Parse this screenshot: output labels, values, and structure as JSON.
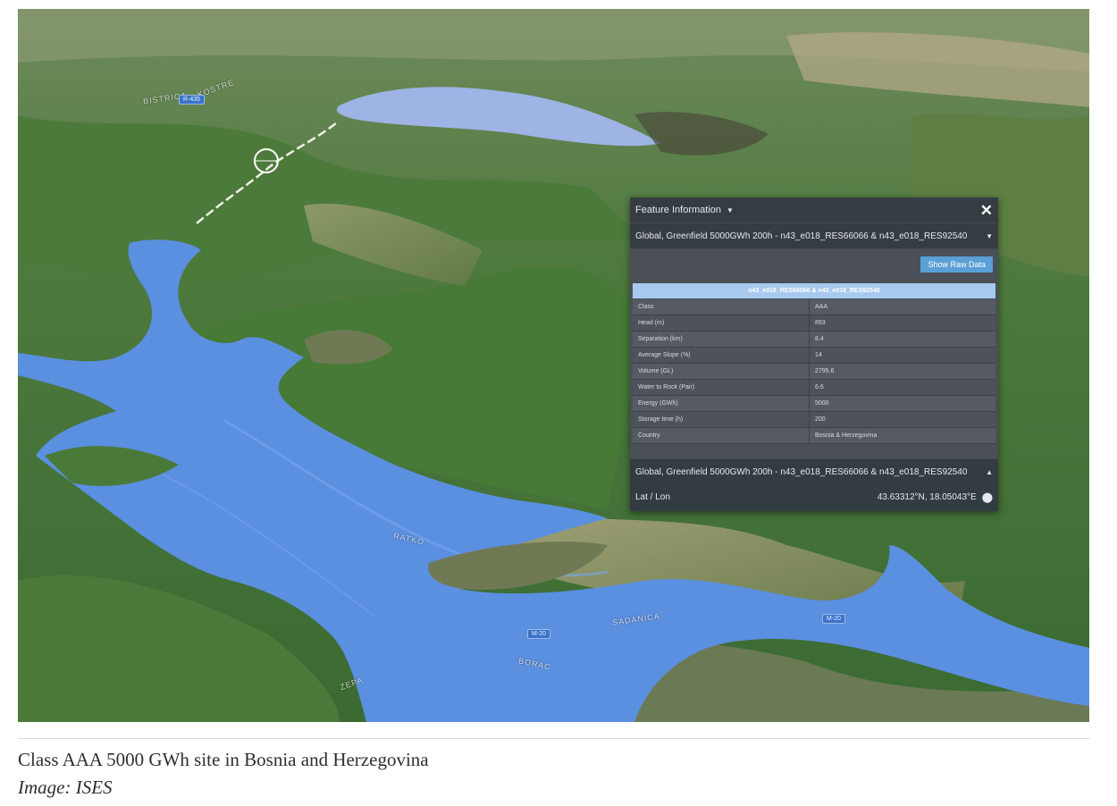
{
  "map": {
    "labels": [
      "RATKO",
      "SADANICA",
      "KOSTRE",
      "BORAC",
      "ZEPA",
      "BISTRICA"
    ],
    "road_badges": [
      "M-20",
      "M-20",
      "R-435"
    ],
    "colors": {
      "water": "#5b8fe0",
      "forest": "#3f6b35",
      "ridge": "#8c8a6c"
    }
  },
  "panel": {
    "title": "Feature Information",
    "feature_top": "Global, Greenfield 5000GWh 200h - n43_e018_RES66066 & n43_e018_RES92540",
    "raw_button": "Show Raw Data",
    "table_title": "n43_e018_RES66066 & n43_e018_RES92540",
    "rows": [
      {
        "key": "Class",
        "value": "AAA"
      },
      {
        "key": "Head (m)",
        "value": "893"
      },
      {
        "key": "Separation (km)",
        "value": "8.4"
      },
      {
        "key": "Average Slope (%)",
        "value": "14"
      },
      {
        "key": "Volume (GL)",
        "value": "2795.6"
      },
      {
        "key": "Water to Rock (Pair)",
        "value": "6.6"
      },
      {
        "key": "Energy (GWh)",
        "value": "5000"
      },
      {
        "key": "Storage time (h)",
        "value": "200"
      },
      {
        "key": "Country",
        "value": "Bosnia & Herzegovina"
      }
    ],
    "feature_bottom": "Global, Greenfield 5000GWh 200h - n43_e018_RES66066 & n43_e018_RES92540",
    "latlon_label": "Lat / Lon",
    "latlon_value": "43.63312°N, 18.05043°E"
  },
  "caption": {
    "text": "Class AAA 5000 GWh site in Bosnia and Herzegovina",
    "credit": "Image: ISES"
  }
}
